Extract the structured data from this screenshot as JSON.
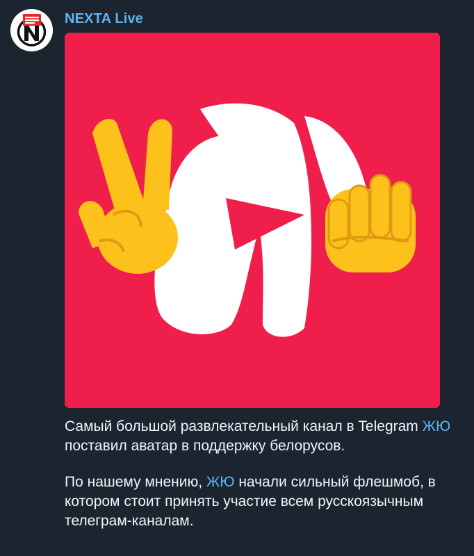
{
  "channel": {
    "name": "NEXTA Live"
  },
  "post": {
    "paragraph1": {
      "before": "Самый большой развлекательный канал в Telegram ",
      "link": "ЖЮ",
      "after": " поставил аватар в поддержку белорусов."
    },
    "paragraph2": {
      "before": "По нашему мнению, ",
      "link": "ЖЮ",
      "after": " начали сильный флешмоб, в котором стоит принять участие всем русскоязычным телеграм-каналам."
    }
  },
  "colors": {
    "background": "#1c2430",
    "accent_link": "#5fb3f2",
    "media_red": "#ef1e4b",
    "emoji_yellow": "#fcc21b"
  },
  "icons": {
    "avatar": "nexta-logo",
    "left_hand": "victory-hand-emoji",
    "right_hand": "raised-fist-emoji",
    "logo": "play-logo"
  }
}
